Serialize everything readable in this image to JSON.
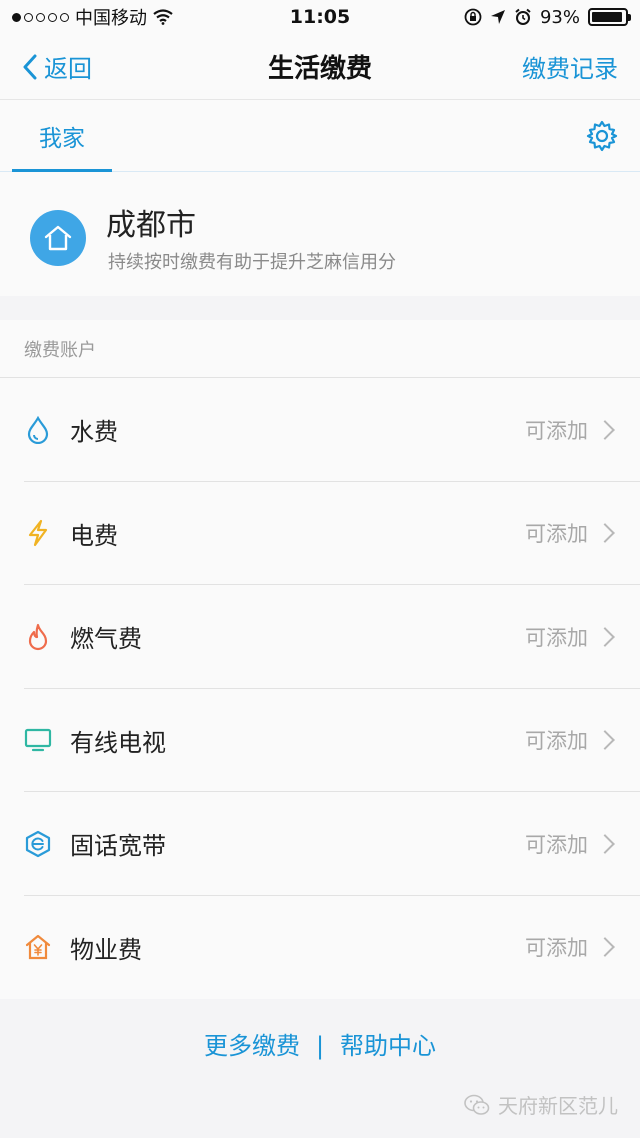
{
  "status_bar": {
    "carrier": "中国移动",
    "time": "11:05",
    "battery_percent": "93%",
    "battery_level": 0.93,
    "signal_dots_filled": 1,
    "signal_dots_total": 5
  },
  "nav": {
    "back_label": "返回",
    "title": "生活缴费",
    "right_label": "缴费记录"
  },
  "tabs": {
    "active_label": "我家"
  },
  "home": {
    "city": "成都市",
    "subtitle": "持续按时缴费有助于提升芝麻信用分"
  },
  "section": {
    "label": "缴费账户"
  },
  "accounts": [
    {
      "label": "水费",
      "action": "可添加",
      "icon": "water-drop-icon",
      "color": "#2a9bd8"
    },
    {
      "label": "电费",
      "action": "可添加",
      "icon": "lightning-icon",
      "color": "#f0b323"
    },
    {
      "label": "燃气费",
      "action": "可添加",
      "icon": "flame-icon",
      "color": "#ef6c4c"
    },
    {
      "label": "有线电视",
      "action": "可添加",
      "icon": "tv-icon",
      "color": "#2fb7a3"
    },
    {
      "label": "固话宽带",
      "action": "可添加",
      "icon": "broadband-icon",
      "color": "#2a9bd8"
    },
    {
      "label": "物业费",
      "action": "可添加",
      "icon": "property-icon",
      "color": "#f08a3c"
    }
  ],
  "footer": {
    "more_label": "更多缴费",
    "separator": "|",
    "help_label": "帮助中心"
  },
  "watermark": {
    "text": "天府新区范儿"
  },
  "colors": {
    "accent": "#1a94d6",
    "home_icon_bg": "#3fa6e6"
  }
}
